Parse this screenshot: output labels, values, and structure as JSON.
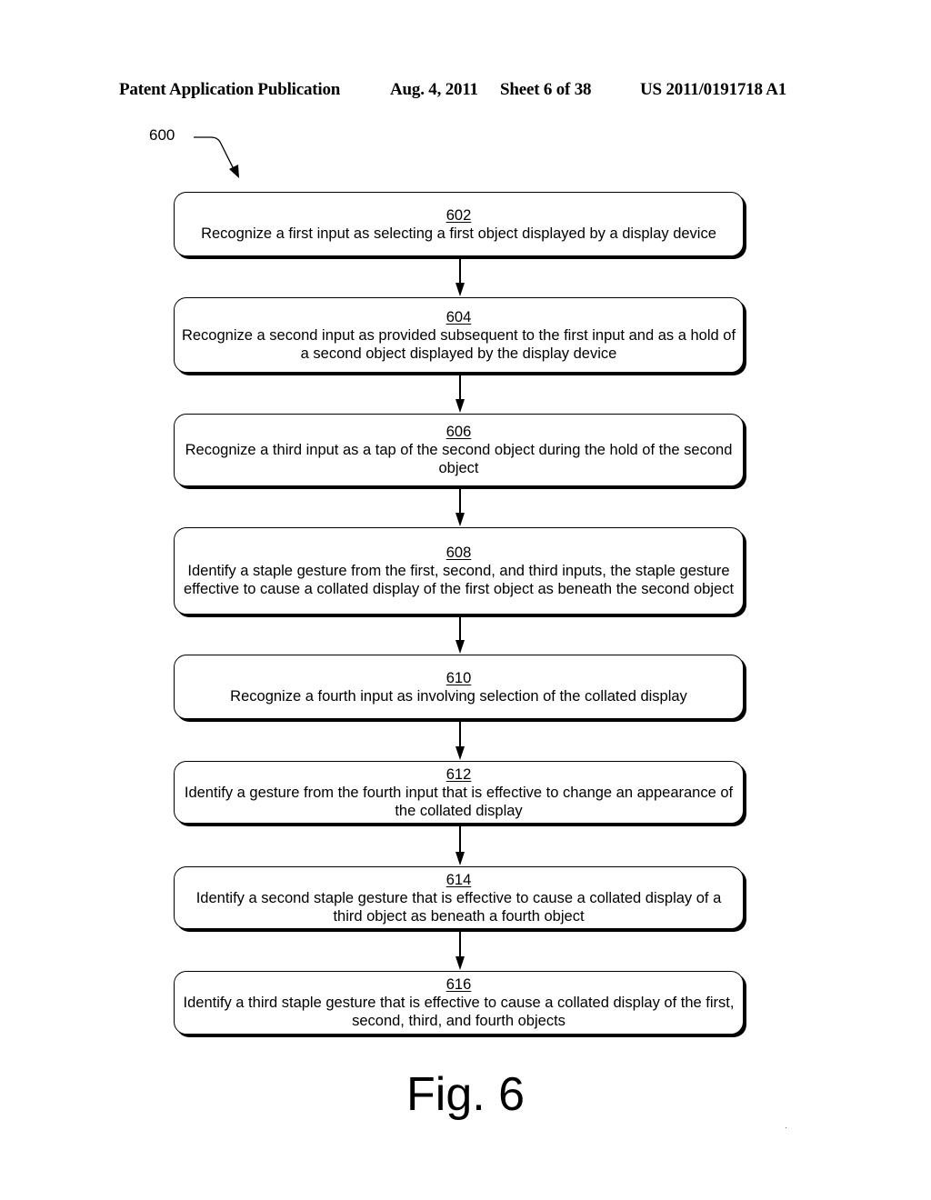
{
  "header": {
    "publication": "Patent Application Publication",
    "date": "Aug. 4, 2011",
    "sheet": "Sheet 6 of 38",
    "number": "US 2011/0191718 A1"
  },
  "diagram": {
    "reference": "600",
    "steps": [
      {
        "id": "602",
        "text": "Recognize a first input as selecting a first object displayed by a display device"
      },
      {
        "id": "604",
        "text": "Recognize a second input as provided subsequent to the first input and as a hold of a second object displayed by the display device"
      },
      {
        "id": "606",
        "text": "Recognize a third input as a tap of the second object during the hold of the second object"
      },
      {
        "id": "608",
        "text": "Identify a staple gesture from the first, second, and third inputs, the staple gesture effective to cause a collated display of the first object as beneath the second object"
      },
      {
        "id": "610",
        "text": "Recognize a fourth input as involving selection of the collated display"
      },
      {
        "id": "612",
        "text": "Identify a gesture from the fourth input that is effective to change an appearance of the collated display"
      },
      {
        "id": "614",
        "text": "Identify a second staple gesture that is effective to cause a collated display of a third object as beneath a fourth object"
      },
      {
        "id": "616",
        "text": "Identify a third staple gesture that is effective to cause a collated display of the first, second, third, and fourth objects"
      }
    ]
  },
  "caption": "Fig. 6"
}
